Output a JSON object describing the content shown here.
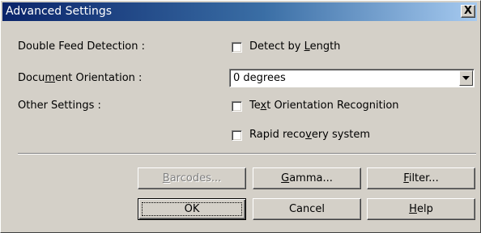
{
  "window": {
    "title": "Advanced Settings",
    "close_glyph": "X"
  },
  "settings": {
    "double_feed_label": "Double Feed Detection :",
    "orientation_label": [
      "Docu",
      "m",
      "ent Orientation :"
    ],
    "other_label": "Other Settings :",
    "detect_by_length": {
      "label": [
        "Detect by ",
        "L",
        "ength"
      ],
      "checked": false
    },
    "orientation_select": {
      "value": "0 degrees"
    },
    "text_orientation": {
      "label": [
        "Te",
        "x",
        "t Orientation Recognition"
      ],
      "checked": false
    },
    "rapid_recovery": {
      "label": [
        "Rapid reco",
        "v",
        "ery system"
      ],
      "checked": false
    }
  },
  "buttons": {
    "barcodes": [
      "B",
      "arcodes..."
    ],
    "gamma": [
      "G",
      "amma..."
    ],
    "filter": [
      "F",
      "ilter..."
    ],
    "ok": "OK",
    "cancel": "Cancel",
    "help": [
      "H",
      "elp"
    ]
  },
  "colors": {
    "face": "#d4d0c8",
    "title_start": "#0a246a",
    "title_end": "#a6caf0"
  },
  "icons": {
    "close": "close-icon",
    "dropdown": "chevron-down-icon"
  }
}
